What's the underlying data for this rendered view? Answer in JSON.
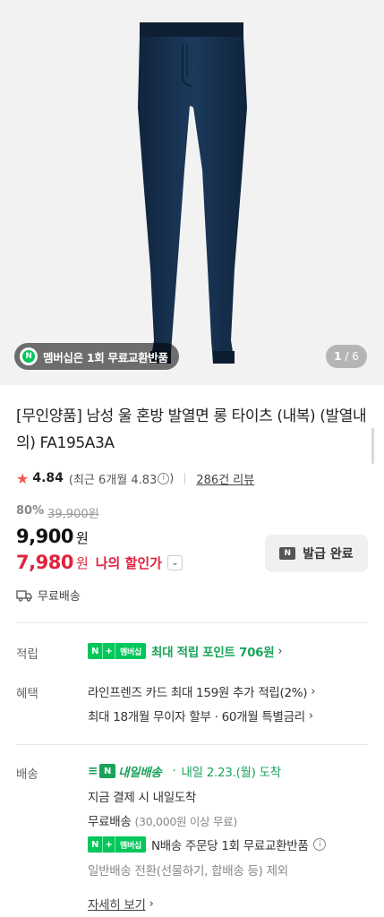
{
  "gallery": {
    "membership_badge": "멤버십은 1회 무료교환반품",
    "badge_icon": "N",
    "page_current": "1",
    "page_total": "/ 6"
  },
  "product": {
    "title": "[무인양품] 남성 울 혼방 발열면 롱 타이츠 (내복) (발열내의) FA195A3A"
  },
  "rating": {
    "score": "4.84",
    "recent": "(최근 6개월 4.83",
    "recent_close": ")",
    "info_icon": "i",
    "reviews": "286건 리뷰",
    "star_color": "#f15746"
  },
  "price": {
    "discount_rate": "80%",
    "original": "39,900원",
    "sale": "9,900",
    "sale_unit": "원",
    "my_price": "7,980",
    "my_price_unit": "원",
    "my_price_label": "나의 할인가",
    "accent_color": "#e0233c"
  },
  "coupon": {
    "icon": "N",
    "label": "발급 완료"
  },
  "shipping_summary": {
    "label": "무료배송"
  },
  "points": {
    "label": "적립",
    "badge_n": "N",
    "badge_plus": "+",
    "badge_membership": "멤버십",
    "text": "최대 적립 포인트 706원",
    "chevron": "›"
  },
  "benefits": {
    "label": "혜택",
    "line1": "라인프렌즈 카드 최대 159원 추가 적립(2%)",
    "line2": "최대 18개월 무이자 할부 · 60개월 특별금리",
    "chevron": "›"
  },
  "delivery": {
    "label": "배송",
    "tomorrow_n": "N",
    "tomorrow_text": "내일배송",
    "separator": "·",
    "arrival": "내일 2.23.(월) 도착",
    "line_pay": "지금 결제 시 내일도착",
    "free_label": "무료배송",
    "free_condition": "(30,000원 이상 무료)",
    "badge_n": "N",
    "badge_plus": "+",
    "badge_membership": "멤버십",
    "exchange_text": "N배송 주문당 1회 무료교환반품",
    "info_icon": "i",
    "exception": "일반배송 전환(선물하기, 합배송 등) 제외",
    "detail_link": "자세히 보기",
    "chevron": "›",
    "brand_green": "#1ba35a"
  }
}
